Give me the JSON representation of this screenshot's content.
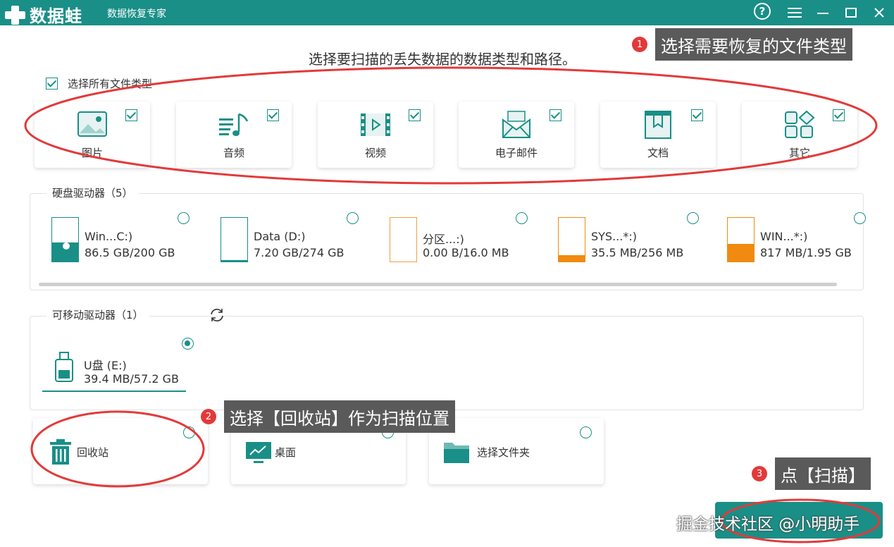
{
  "app": {
    "brand": "数据蛙",
    "subtitle": "数据恢复专家"
  },
  "window_controls": {
    "help": "?"
  },
  "prompt": "选择要扫描的丢失数据的数据类型和路径。",
  "select_all_label": "选择所有文件类型",
  "file_types": [
    {
      "label": "图片",
      "icon": "image-icon",
      "checked": true
    },
    {
      "label": "音频",
      "icon": "music-icon",
      "checked": true
    },
    {
      "label": "视频",
      "icon": "video-icon",
      "checked": true
    },
    {
      "label": "电子邮件",
      "icon": "email-icon",
      "checked": true
    },
    {
      "label": "文档",
      "icon": "document-icon",
      "checked": true
    },
    {
      "label": "其它",
      "icon": "other-icon",
      "checked": true
    }
  ],
  "hard_drives": {
    "heading": "硬盘驱动器（5）",
    "items": [
      {
        "name": "Win...C:)",
        "size": "86.5 GB/200 GB",
        "used_fraction": 0.43,
        "color": "#198f87"
      },
      {
        "name": "Data (D:)",
        "size": "7.20 GB/274 GB",
        "used_fraction": 0.03,
        "color": "#198f87"
      },
      {
        "name": "分区...:)",
        "size": "0.00  B/16.0 MB",
        "used_fraction": 0.0,
        "color": "#f0a040"
      },
      {
        "name": "SYS...*:)",
        "size": "35.5 MB/256 MB",
        "used_fraction": 0.14,
        "color": "#f08a10"
      },
      {
        "name": "WIN...*:)",
        "size": "817 MB/1.95 GB",
        "used_fraction": 0.41,
        "color": "#f08a10"
      }
    ]
  },
  "removable_drives": {
    "heading": "可移动驱动器（1）",
    "items": [
      {
        "name": "U盘 (E:)",
        "size": "39.4 MB/57.2 GB",
        "selected": true
      }
    ]
  },
  "locations": [
    {
      "label": "回收站",
      "icon": "trash-icon"
    },
    {
      "label": "桌面",
      "icon": "desktop-icon"
    },
    {
      "label": "选择文件夹",
      "icon": "folder-icon"
    }
  ],
  "annotations": [
    {
      "number": "1",
      "text": "选择需要恢复的文件类型"
    },
    {
      "number": "2",
      "text": "选择【回收站】作为扫描位置"
    },
    {
      "number": "3",
      "text": "点【扫描】"
    }
  ],
  "watermark": "掘金技术社区 @小明助手",
  "colors": {
    "accent": "#198f87",
    "highlight": "#e23a3a",
    "callout": "#5a5a5a"
  }
}
